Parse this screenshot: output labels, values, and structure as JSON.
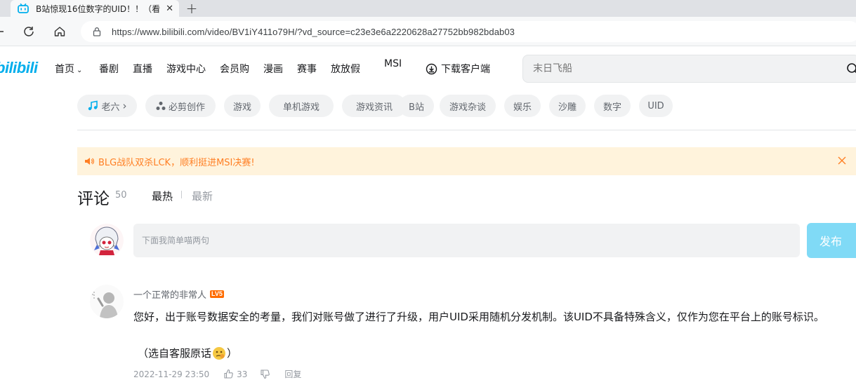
{
  "browser": {
    "tab_title": "B站惊现16位数字的UID！！（看",
    "tab_close": "✕",
    "new_tab": "+",
    "url": "https://www.bilibili.com/video/BV1iY411o79H/?vd_source=c23e3e6a2220628a27752bb982bdab03"
  },
  "header": {
    "logo": "bilibili",
    "nav": [
      "首页",
      "番剧",
      "直播",
      "游戏中心",
      "会员购",
      "漫画",
      "赛事",
      "放放假",
      "MSI"
    ],
    "download_label": "下载客户端",
    "search_placeholder": "末日飞船",
    "accent": "#00aeec"
  },
  "tags": [
    {
      "label": "老六",
      "icon": "music-note-icon",
      "arrow": "›"
    },
    {
      "label": "必剪创作",
      "icon": "scissors-icon"
    },
    {
      "label": "游戏"
    },
    {
      "label": "单机游戏"
    },
    {
      "label": "游戏资讯"
    },
    {
      "label": "B站"
    },
    {
      "label": "游戏杂谈"
    },
    {
      "label": "娱乐"
    },
    {
      "label": "沙雕"
    },
    {
      "label": "数字"
    },
    {
      "label": "UID"
    }
  ],
  "notice": {
    "text": "BLG战队双杀LCK，顺利挺进MSI决赛!",
    "color": "#ff7f24"
  },
  "comments": {
    "title": "评论",
    "count": "50",
    "sort_hot": "最热",
    "sort_new": "最新",
    "reply_placeholder": "下面我简单喵两句",
    "publish_label": "发布",
    "items": [
      {
        "user": "一个正常的非常人",
        "level": "LV5",
        "text": "您好，出于账号数据安全的考量，我们对账号做了进行了升级，用户UID采用随机分发机制。该UID不具备特殊含义，仅作为您在平台上的账号标识。",
        "quote_open": "（选自客服原话",
        "quote_close": "）",
        "date": "2022-11-29 23:50",
        "likes": "33",
        "reply_label": "回复"
      }
    ]
  }
}
